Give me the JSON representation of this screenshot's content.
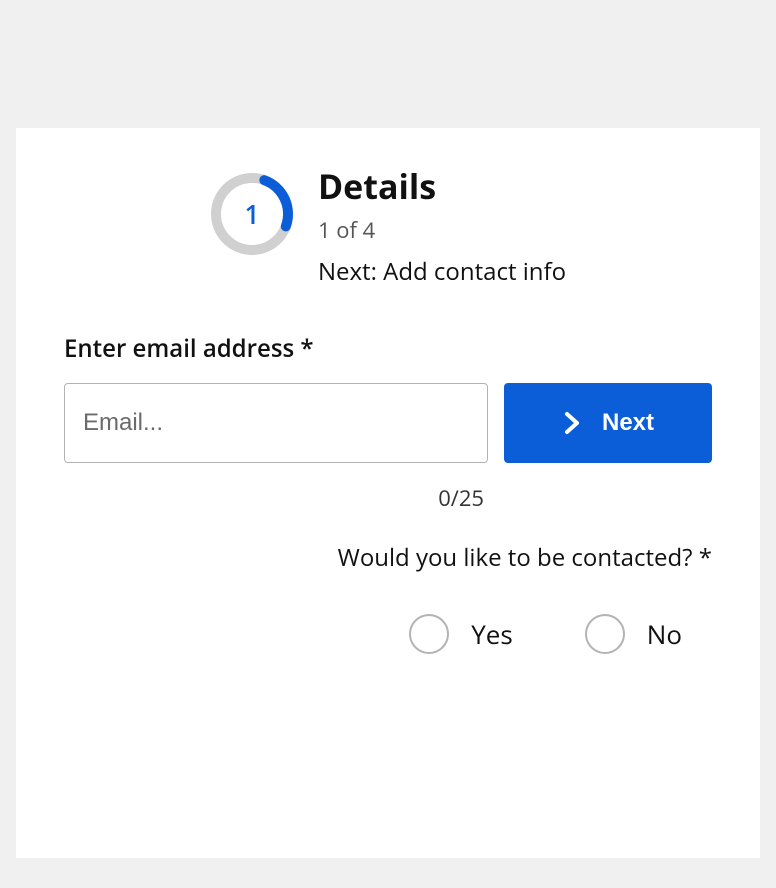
{
  "stepper": {
    "current_step": "1",
    "total_steps": "4",
    "title": "Details",
    "counter_label": "1 of 4",
    "next_prefix": "Next: ",
    "next_step_name": "Add contact info"
  },
  "email_field": {
    "label": "Enter email address",
    "required_marker": " *",
    "placeholder": "Email...",
    "value": "",
    "max_length": "25",
    "char_counter": "0/25"
  },
  "next_button": {
    "label": "Next"
  },
  "contact_question": {
    "label": "Would you like to be contacted?",
    "required_marker": " *",
    "options": [
      {
        "label": "Yes",
        "value": "yes"
      },
      {
        "label": "No",
        "value": "no"
      }
    ]
  }
}
